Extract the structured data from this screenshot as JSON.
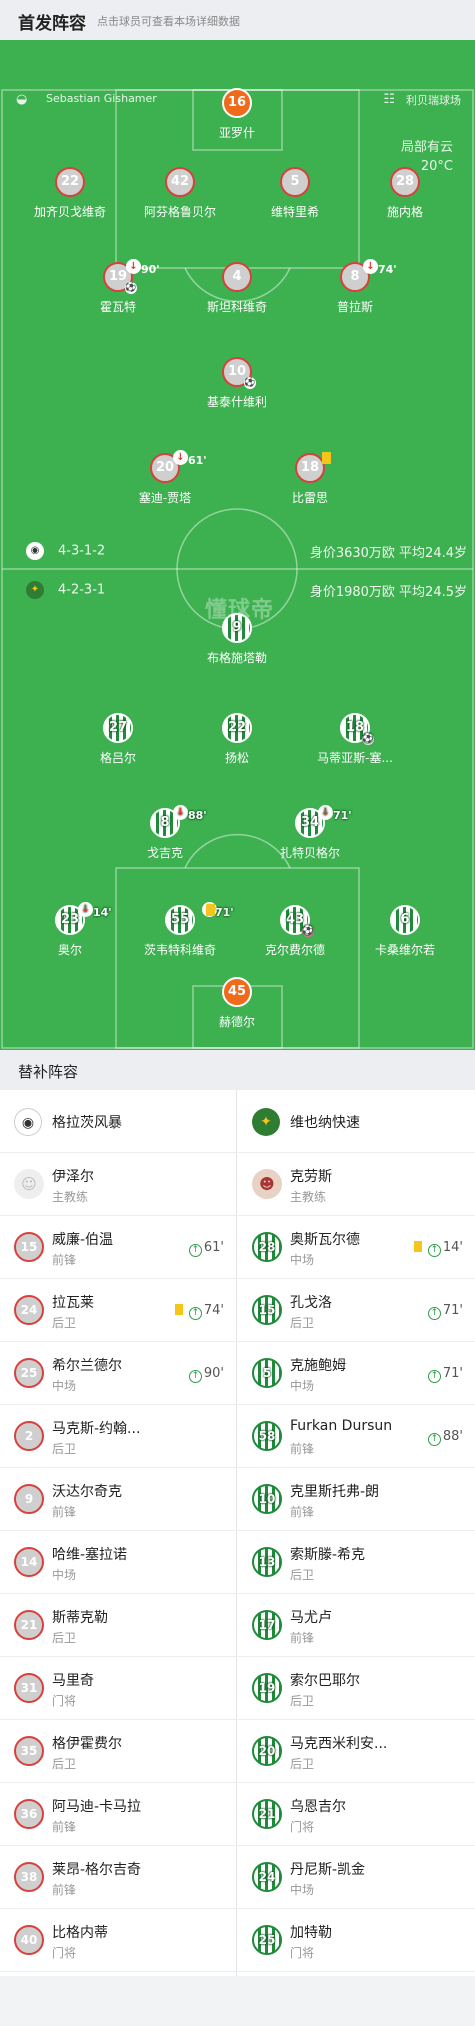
{
  "header": {
    "title": "首发阵容",
    "subtitle": "点击球员可查看本场详细数据"
  },
  "pitch": {
    "referee": "Sebastian Gishamer",
    "referee_icon": "whistle-icon",
    "venue": "利贝瑞球场",
    "venue_icon": "stadium-icon",
    "weather": "局部有云",
    "temperature": "20°C",
    "home_formation": "4-3-1-2",
    "home_value": "身价3630万欧 平均24.4岁",
    "away_formation": "4-2-3-1",
    "away_value": "身价1980万欧 平均24.5岁",
    "watermark": "懂球帝"
  },
  "home_players": [
    {
      "num": "16",
      "name": "亚罗什",
      "gk": true
    },
    {
      "num": "22",
      "name": "加齐贝戈维奇"
    },
    {
      "num": "42",
      "name": "阿芬格鲁贝尔"
    },
    {
      "num": "5",
      "name": "维特里希"
    },
    {
      "num": "28",
      "name": "施内格"
    },
    {
      "num": "19",
      "name": "霍瓦特",
      "sub_min": "90'",
      "goal": true
    },
    {
      "num": "4",
      "name": "斯坦科维奇"
    },
    {
      "num": "8",
      "name": "普拉斯",
      "sub_min": "74'"
    },
    {
      "num": "10",
      "name": "基泰什维利",
      "goal": true
    },
    {
      "num": "20",
      "name": "塞迪-贾塔",
      "sub_min": "61'"
    },
    {
      "num": "18",
      "name": "比雷思",
      "yellow": true
    }
  ],
  "away_players": [
    {
      "num": "9",
      "name": "布格施塔勒"
    },
    {
      "num": "27",
      "name": "格吕尔"
    },
    {
      "num": "22",
      "name": "扬松"
    },
    {
      "num": "18",
      "name": "马蒂亚斯-塞...",
      "goal": true
    },
    {
      "num": "8",
      "name": "戈吉克",
      "sub_min": "88'"
    },
    {
      "num": "34",
      "name": "扎特贝格尔",
      "sub_min": "71'"
    },
    {
      "num": "23",
      "name": "奥尔",
      "sub_min": "14'"
    },
    {
      "num": "55",
      "name": "茨韦特科维奇",
      "sub_min": "71'",
      "yellow": true
    },
    {
      "num": "43",
      "name": "克尔费尔德",
      "own_goal": true
    },
    {
      "num": "6",
      "name": "卡桑维尔若"
    },
    {
      "num": "45",
      "name": "赫德尔",
      "gk": true
    }
  ],
  "subs_title": "替补阵容",
  "home_team": {
    "name": "格拉茨风暴",
    "logo": "sturm-graz-logo"
  },
  "away_team": {
    "name": "维也纳快速",
    "logo": "rapid-wien-logo"
  },
  "home_coach": {
    "name": "伊泽尔",
    "role": "主教练"
  },
  "away_coach": {
    "name": "克劳斯",
    "role": "主教练"
  },
  "home_subs": [
    {
      "num": "15",
      "name": "威廉-伯温",
      "pos": "前锋",
      "sub_in": "61'"
    },
    {
      "num": "24",
      "name": "拉瓦莱",
      "pos": "后卫",
      "sub_in": "74'",
      "yellow": true
    },
    {
      "num": "25",
      "name": "希尔兰德尔",
      "pos": "中场",
      "sub_in": "90'"
    },
    {
      "num": "2",
      "name": "马克斯-约翰...",
      "pos": "后卫"
    },
    {
      "num": "9",
      "name": "沃达尔奇克",
      "pos": "前锋"
    },
    {
      "num": "14",
      "name": "哈维-塞拉诺",
      "pos": "中场"
    },
    {
      "num": "21",
      "name": "斯蒂克勒",
      "pos": "后卫"
    },
    {
      "num": "31",
      "name": "马里奇",
      "pos": "门将"
    },
    {
      "num": "35",
      "name": "格伊霍费尔",
      "pos": "后卫"
    },
    {
      "num": "36",
      "name": "阿马迪-卡马拉",
      "pos": "前锋"
    },
    {
      "num": "38",
      "name": "莱昂-格尔吉奇",
      "pos": "前锋"
    },
    {
      "num": "40",
      "name": "比格内蒂",
      "pos": "门将"
    }
  ],
  "away_subs": [
    {
      "num": "28",
      "name": "奥斯瓦尔德",
      "pos": "中场",
      "sub_in": "14'",
      "yellow": true
    },
    {
      "num": "15",
      "name": "孔戈洛",
      "pos": "后卫",
      "sub_in": "71'"
    },
    {
      "num": "5",
      "name": "克施鲍姆",
      "pos": "中场",
      "sub_in": "71'"
    },
    {
      "num": "58",
      "name": "Furkan Dursun",
      "pos": "前锋",
      "sub_in": "88'"
    },
    {
      "num": "10",
      "name": "克里斯托弗-朗",
      "pos": "前锋"
    },
    {
      "num": "13",
      "name": "索斯滕-希克",
      "pos": "后卫"
    },
    {
      "num": "17",
      "name": "马尤卢",
      "pos": "前锋"
    },
    {
      "num": "19",
      "name": "索尔巴耶尔",
      "pos": "后卫"
    },
    {
      "num": "20",
      "name": "马克西米利安...",
      "pos": "后卫"
    },
    {
      "num": "21",
      "name": "乌恩吉尔",
      "pos": "门将"
    },
    {
      "num": "24",
      "name": "丹尼斯-凯金",
      "pos": "中场"
    },
    {
      "num": "25",
      "name": "加特勒",
      "pos": "门将"
    }
  ],
  "colors": {
    "pitch": "#3db050",
    "home_ring": "#d8413b",
    "away_stripe": "#1e8a3a",
    "gk": "#f06a1c",
    "yellow_card": "#f6c51c"
  }
}
